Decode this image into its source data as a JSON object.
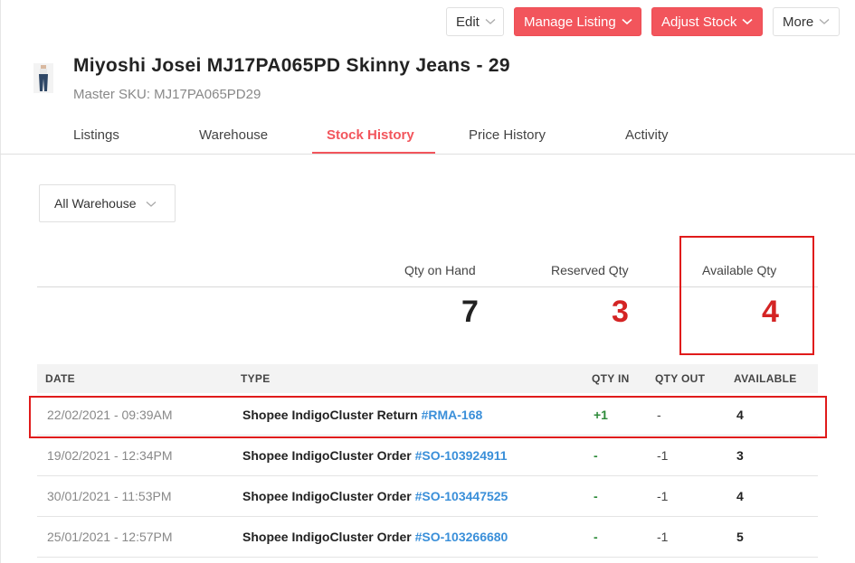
{
  "toolbar": {
    "edit_label": "Edit",
    "manage_listing_label": "Manage Listing",
    "adjust_stock_label": "Adjust Stock",
    "more_label": "More"
  },
  "product": {
    "title": "Miyoshi Josei MJ17PA065PD Skinny Jeans - 29",
    "sku_label": "Master SKU: MJ17PA065PD29"
  },
  "tabs": [
    {
      "label": "Listings",
      "active": false
    },
    {
      "label": "Warehouse",
      "active": false
    },
    {
      "label": "Stock History",
      "active": true
    },
    {
      "label": "Price History",
      "active": false
    },
    {
      "label": "Activity",
      "active": false
    }
  ],
  "filter": {
    "warehouse_selected": "All Warehouse"
  },
  "summary": {
    "qty_on_hand_label": "Qty on Hand",
    "qty_on_hand_value": "7",
    "reserved_qty_label": "Reserved Qty",
    "reserved_qty_value": "3",
    "available_qty_label": "Available Qty",
    "available_qty_value": "4"
  },
  "table": {
    "headers": {
      "date": "DATE",
      "type": "TYPE",
      "qty_in": "QTY IN",
      "qty_out": "QTY OUT",
      "available": "AVAILABLE"
    },
    "rows": [
      {
        "date": "22/02/2021 - 09:39AM",
        "type": "Shopee IndigoCluster Return",
        "ref": "#RMA-168",
        "qty_in": "+1",
        "qty_out": "-",
        "available": "4"
      },
      {
        "date": "19/02/2021 - 12:34PM",
        "type": "Shopee IndigoCluster Order",
        "ref": "#SO-103924911",
        "qty_in": "-",
        "qty_out": "-1",
        "available": "3"
      },
      {
        "date": "30/01/2021 - 11:53PM",
        "type": "Shopee IndigoCluster Order",
        "ref": "#SO-103447525",
        "qty_in": "-",
        "qty_out": "-1",
        "available": "4"
      },
      {
        "date": "25/01/2021 - 12:57PM",
        "type": "Shopee IndigoCluster Order",
        "ref": "#SO-103266680",
        "qty_in": "-",
        "qty_out": "-1",
        "available": "5"
      }
    ]
  },
  "colors": {
    "accent": "#f2555c",
    "highlight": "#e01b1b",
    "link": "#3a8fd9",
    "qty_in": "#2e8b3a"
  }
}
